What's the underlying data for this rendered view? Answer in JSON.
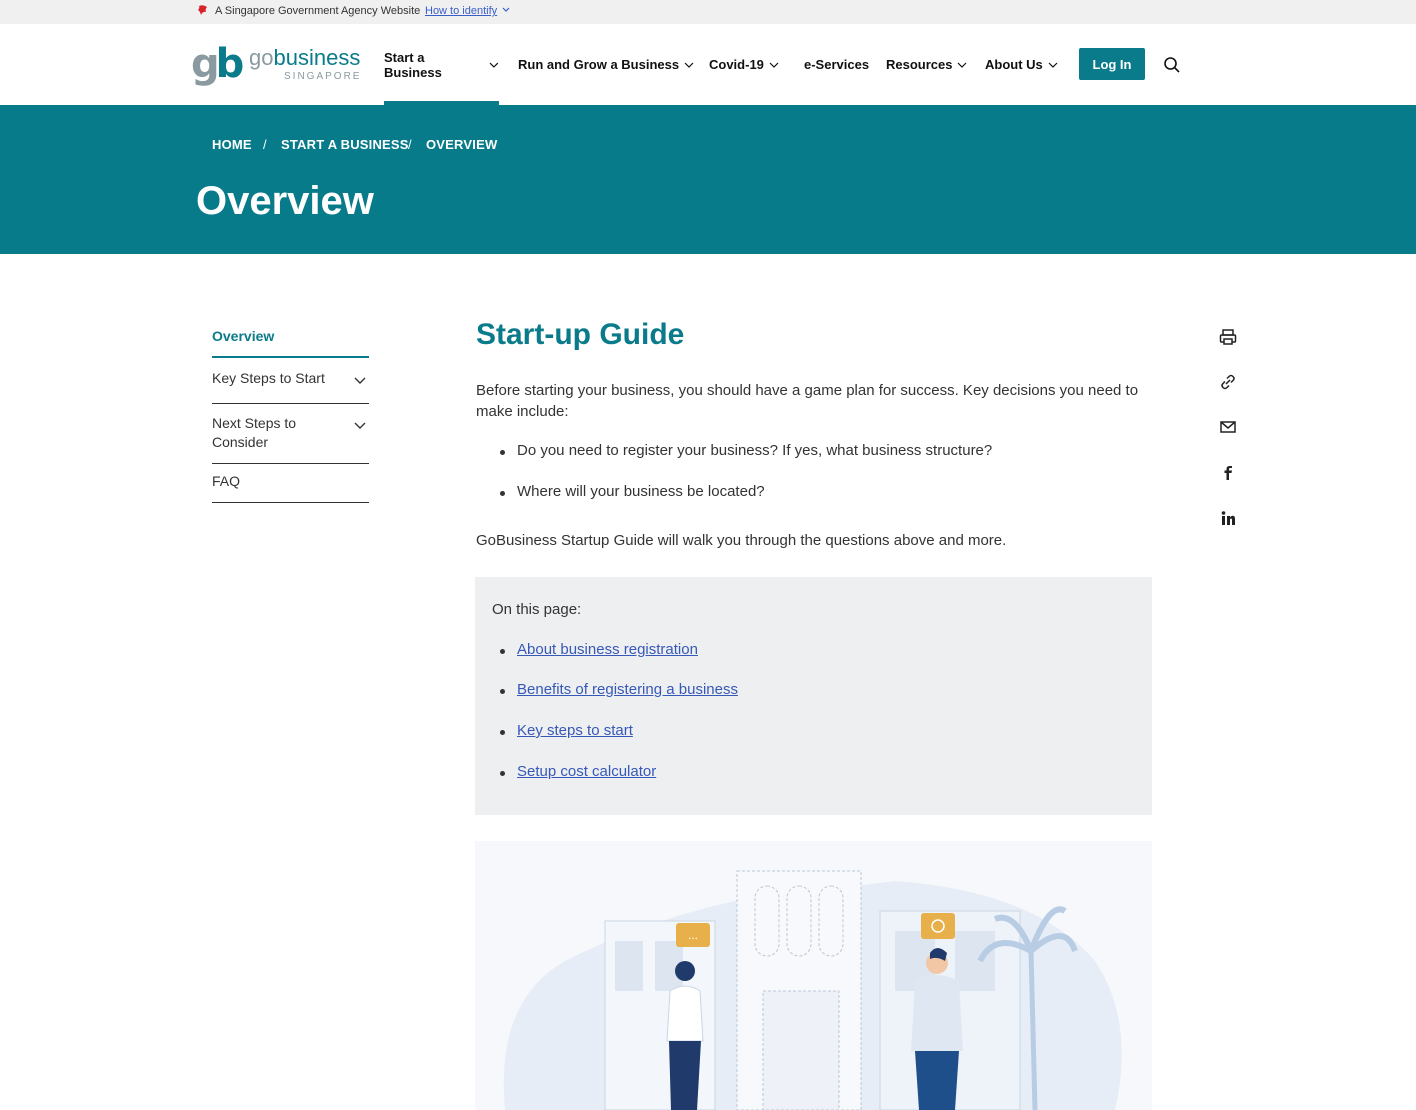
{
  "masthead": {
    "text": "A Singapore Government Agency Website",
    "identify_link": "How to identify"
  },
  "logo": {
    "mark_g": "g",
    "mark_b": "b",
    "word_go": "go",
    "word_business": "business",
    "tagline": "SINGAPORE"
  },
  "nav": {
    "items": [
      {
        "label": "Start a Business",
        "active": true
      },
      {
        "label": "Run and Grow a Business"
      },
      {
        "label": "Covid-19"
      },
      {
        "label": "e-Services"
      },
      {
        "label": "Resources"
      },
      {
        "label": "About Us"
      }
    ],
    "login": "Log In",
    "search_icon": "search-icon"
  },
  "hero": {
    "breadcrumb": [
      "HOME",
      "START A BUSINESS",
      "OVERVIEW"
    ],
    "separator": "/",
    "title": "Overview"
  },
  "sidebar": {
    "items": [
      {
        "label": "Overview",
        "active": true
      },
      {
        "label": "Key Steps to Start",
        "expandable": true
      },
      {
        "label_line1": "Next Steps to",
        "label_line2": "Consider",
        "expandable": true
      },
      {
        "label": "FAQ"
      }
    ]
  },
  "content": {
    "heading": "Start-up Guide",
    "intro": "Before starting your business, you should have a game plan for success. Key decisions you need to make include:",
    "bullets": [
      "Do you need to register your business? If yes, what business structure?",
      "Where will your business be located?"
    ],
    "outro": "GoBusiness Startup Guide will walk you through the questions above and more.",
    "toc_title": "On this page:",
    "toc_links": [
      "About business registration",
      "Benefits of registering a business",
      "Key steps to start",
      "Setup cost calculator"
    ],
    "bubble_left": "...",
    "illustration": "two-people-street-illustration"
  },
  "share": [
    "print-icon",
    "link-icon",
    "mail-icon",
    "facebook-icon",
    "linkedin-icon"
  ],
  "colors": {
    "brand": "#0a7b8a",
    "hero_bg": "#087b8a",
    "link": "#3658b8",
    "toc_bg": "#eeeff0"
  }
}
